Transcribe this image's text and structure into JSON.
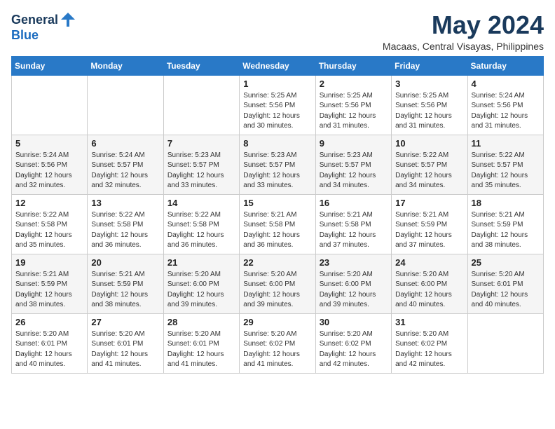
{
  "header": {
    "logo_general": "General",
    "logo_blue": "Blue",
    "month_year": "May 2024",
    "location": "Macaas, Central Visayas, Philippines"
  },
  "calendar": {
    "days_of_week": [
      "Sunday",
      "Monday",
      "Tuesday",
      "Wednesday",
      "Thursday",
      "Friday",
      "Saturday"
    ],
    "weeks": [
      [
        {
          "day": "",
          "info": ""
        },
        {
          "day": "",
          "info": ""
        },
        {
          "day": "",
          "info": ""
        },
        {
          "day": "1",
          "info": "Sunrise: 5:25 AM\nSunset: 5:56 PM\nDaylight: 12 hours\nand 30 minutes."
        },
        {
          "day": "2",
          "info": "Sunrise: 5:25 AM\nSunset: 5:56 PM\nDaylight: 12 hours\nand 31 minutes."
        },
        {
          "day": "3",
          "info": "Sunrise: 5:25 AM\nSunset: 5:56 PM\nDaylight: 12 hours\nand 31 minutes."
        },
        {
          "day": "4",
          "info": "Sunrise: 5:24 AM\nSunset: 5:56 PM\nDaylight: 12 hours\nand 31 minutes."
        }
      ],
      [
        {
          "day": "5",
          "info": "Sunrise: 5:24 AM\nSunset: 5:56 PM\nDaylight: 12 hours\nand 32 minutes."
        },
        {
          "day": "6",
          "info": "Sunrise: 5:24 AM\nSunset: 5:57 PM\nDaylight: 12 hours\nand 32 minutes."
        },
        {
          "day": "7",
          "info": "Sunrise: 5:23 AM\nSunset: 5:57 PM\nDaylight: 12 hours\nand 33 minutes."
        },
        {
          "day": "8",
          "info": "Sunrise: 5:23 AM\nSunset: 5:57 PM\nDaylight: 12 hours\nand 33 minutes."
        },
        {
          "day": "9",
          "info": "Sunrise: 5:23 AM\nSunset: 5:57 PM\nDaylight: 12 hours\nand 34 minutes."
        },
        {
          "day": "10",
          "info": "Sunrise: 5:22 AM\nSunset: 5:57 PM\nDaylight: 12 hours\nand 34 minutes."
        },
        {
          "day": "11",
          "info": "Sunrise: 5:22 AM\nSunset: 5:57 PM\nDaylight: 12 hours\nand 35 minutes."
        }
      ],
      [
        {
          "day": "12",
          "info": "Sunrise: 5:22 AM\nSunset: 5:58 PM\nDaylight: 12 hours\nand 35 minutes."
        },
        {
          "day": "13",
          "info": "Sunrise: 5:22 AM\nSunset: 5:58 PM\nDaylight: 12 hours\nand 36 minutes."
        },
        {
          "day": "14",
          "info": "Sunrise: 5:22 AM\nSunset: 5:58 PM\nDaylight: 12 hours\nand 36 minutes."
        },
        {
          "day": "15",
          "info": "Sunrise: 5:21 AM\nSunset: 5:58 PM\nDaylight: 12 hours\nand 36 minutes."
        },
        {
          "day": "16",
          "info": "Sunrise: 5:21 AM\nSunset: 5:58 PM\nDaylight: 12 hours\nand 37 minutes."
        },
        {
          "day": "17",
          "info": "Sunrise: 5:21 AM\nSunset: 5:59 PM\nDaylight: 12 hours\nand 37 minutes."
        },
        {
          "day": "18",
          "info": "Sunrise: 5:21 AM\nSunset: 5:59 PM\nDaylight: 12 hours\nand 38 minutes."
        }
      ],
      [
        {
          "day": "19",
          "info": "Sunrise: 5:21 AM\nSunset: 5:59 PM\nDaylight: 12 hours\nand 38 minutes."
        },
        {
          "day": "20",
          "info": "Sunrise: 5:21 AM\nSunset: 5:59 PM\nDaylight: 12 hours\nand 38 minutes."
        },
        {
          "day": "21",
          "info": "Sunrise: 5:20 AM\nSunset: 6:00 PM\nDaylight: 12 hours\nand 39 minutes."
        },
        {
          "day": "22",
          "info": "Sunrise: 5:20 AM\nSunset: 6:00 PM\nDaylight: 12 hours\nand 39 minutes."
        },
        {
          "day": "23",
          "info": "Sunrise: 5:20 AM\nSunset: 6:00 PM\nDaylight: 12 hours\nand 39 minutes."
        },
        {
          "day": "24",
          "info": "Sunrise: 5:20 AM\nSunset: 6:00 PM\nDaylight: 12 hours\nand 40 minutes."
        },
        {
          "day": "25",
          "info": "Sunrise: 5:20 AM\nSunset: 6:01 PM\nDaylight: 12 hours\nand 40 minutes."
        }
      ],
      [
        {
          "day": "26",
          "info": "Sunrise: 5:20 AM\nSunset: 6:01 PM\nDaylight: 12 hours\nand 40 minutes."
        },
        {
          "day": "27",
          "info": "Sunrise: 5:20 AM\nSunset: 6:01 PM\nDaylight: 12 hours\nand 41 minutes."
        },
        {
          "day": "28",
          "info": "Sunrise: 5:20 AM\nSunset: 6:01 PM\nDaylight: 12 hours\nand 41 minutes."
        },
        {
          "day": "29",
          "info": "Sunrise: 5:20 AM\nSunset: 6:02 PM\nDaylight: 12 hours\nand 41 minutes."
        },
        {
          "day": "30",
          "info": "Sunrise: 5:20 AM\nSunset: 6:02 PM\nDaylight: 12 hours\nand 42 minutes."
        },
        {
          "day": "31",
          "info": "Sunrise: 5:20 AM\nSunset: 6:02 PM\nDaylight: 12 hours\nand 42 minutes."
        },
        {
          "day": "",
          "info": ""
        }
      ]
    ]
  }
}
